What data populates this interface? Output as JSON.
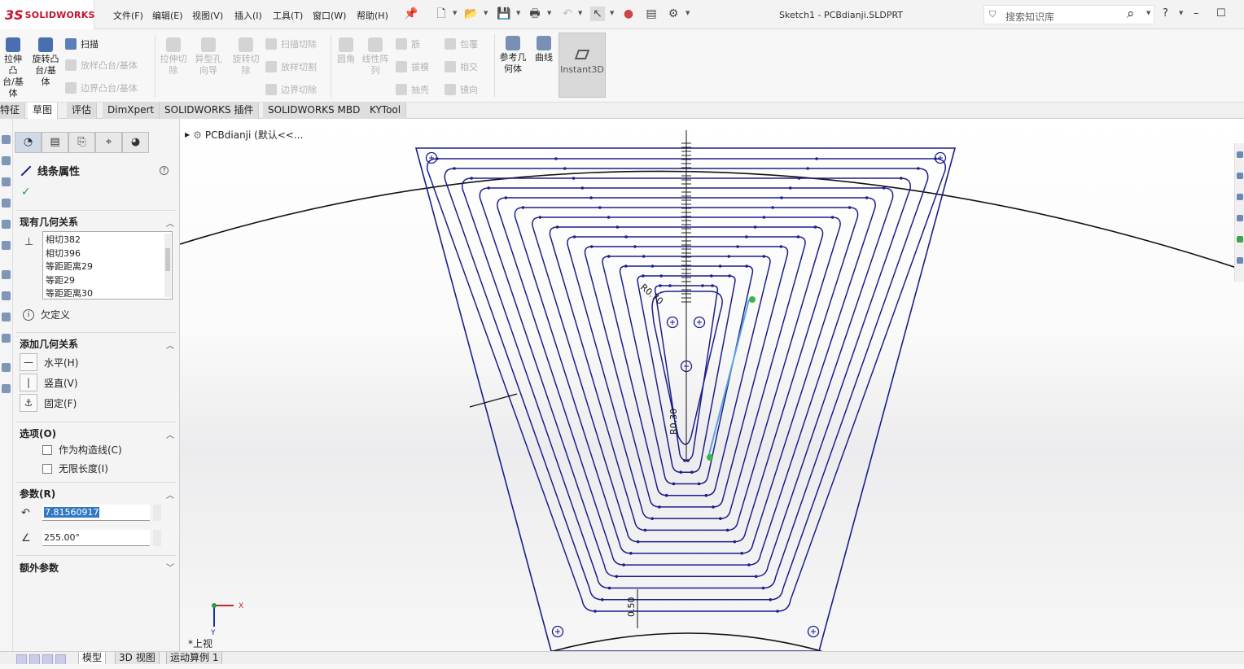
{
  "app": {
    "brand_ds": "3S",
    "brand_name": "SOLIDWORKS",
    "doc_title": "Sketch1 - PCBdianji.SLDPRT"
  },
  "menu": [
    "文件(F)",
    "编辑(E)",
    "视图(V)",
    "插入(I)",
    "工具(T)",
    "窗口(W)",
    "帮助(H)"
  ],
  "search": {
    "placeholder": "搜索知识库"
  },
  "ribbon": {
    "big": [
      {
        "label": "拉伸凸\n台/基\n体",
        "enabled": true
      },
      {
        "label": "旋转凸\n台/基\n体",
        "enabled": true
      },
      {
        "label": "拉伸切\n除",
        "enabled": false
      },
      {
        "label": "异型孔\n向导",
        "enabled": false
      },
      {
        "label": "旋转切\n除",
        "enabled": false
      },
      {
        "label": "圆角",
        "enabled": false
      },
      {
        "label": "线性阵\n列",
        "enabled": false
      },
      {
        "label": "参考几\n何体",
        "enabled": true
      },
      {
        "label": "曲线",
        "enabled": true
      }
    ],
    "small": [
      {
        "label": "扫描",
        "enabled": true
      },
      {
        "label": "放样凸台/基体",
        "enabled": false
      },
      {
        "label": "边界凸台/基体",
        "enabled": false
      },
      {
        "label": "扫描切除",
        "enabled": false
      },
      {
        "label": "放样切割",
        "enabled": false
      },
      {
        "label": "边界切除",
        "enabled": false
      },
      {
        "label": "筋",
        "enabled": false
      },
      {
        "label": "拔模",
        "enabled": false
      },
      {
        "label": "抽壳",
        "enabled": false
      },
      {
        "label": "包覆",
        "enabled": false
      },
      {
        "label": "相交",
        "enabled": false
      },
      {
        "label": "镜向",
        "enabled": false
      }
    ],
    "instant3d": "Instant3D"
  },
  "tabs": [
    {
      "label": "特征",
      "active": false
    },
    {
      "label": "草图",
      "active": true
    },
    {
      "label": "评估",
      "active": false
    },
    {
      "label": "DimXpert",
      "active": false
    },
    {
      "label": "SOLIDWORKS 插件",
      "active": false
    },
    {
      "label": "SOLIDWORKS MBD",
      "active": false
    },
    {
      "label": "KYTool",
      "active": false
    }
  ],
  "property_manager": {
    "title": "线条属性",
    "existing_relations": {
      "header": "现有几何关系",
      "items": [
        "相切382",
        "相切396",
        "等距距离29",
        "等距29",
        "等距距离30"
      ],
      "status": "欠定义"
    },
    "add_relations": {
      "header": "添加几何关系",
      "items": [
        "水平(H)",
        "竖直(V)",
        "固定(F)"
      ]
    },
    "options": {
      "header": "选项(O)",
      "items": [
        {
          "label": "作为构造线(C)",
          "checked": false
        },
        {
          "label": "无限长度(I)",
          "checked": false
        }
      ]
    },
    "parameters": {
      "header": "参数(R)",
      "length": "7.81560917",
      "angle": "255.00°"
    },
    "extra": {
      "header": "额外参数"
    }
  },
  "viewport": {
    "tree_root": "PCBdianji (默认<<...",
    "view_label": "*上视",
    "dims": {
      "top_radius": "R0.70",
      "bottom_offset": "0.50",
      "tip": "R0.30"
    },
    "axis_x": "X",
    "axis_y": "Y"
  },
  "bottom_tabs": [
    {
      "label": "模型",
      "active": true
    },
    {
      "label": "3D 视图",
      "active": false
    },
    {
      "label": "运动算例 1",
      "active": false
    }
  ],
  "colors": {
    "sketch": "#1b1f8a",
    "selected": "#5aa3e0",
    "accent": "#c8102e"
  }
}
